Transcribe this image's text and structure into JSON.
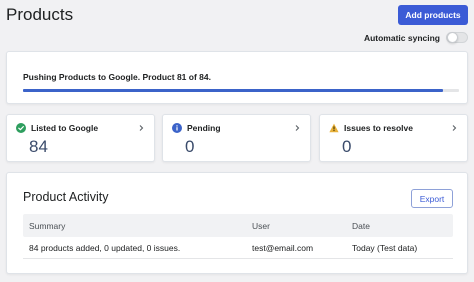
{
  "header": {
    "title": "Products",
    "add_button_label": "Add products",
    "sync_label": "Automatic syncing",
    "sync_enabled": false
  },
  "progress": {
    "message": "Pushing Products to Google. Product 81 of 84.",
    "current": 81,
    "total": 84,
    "fraction": 0.964
  },
  "stats": [
    {
      "label": "Listed to Google",
      "value": "84",
      "icon": "check-circle-icon",
      "icon_color": "#2e9e5e"
    },
    {
      "label": "Pending",
      "value": "0",
      "icon": "info-circle-icon",
      "icon_color": "#3b63c9"
    },
    {
      "label": "Issues to resolve",
      "value": "0",
      "icon": "warning-triangle-icon",
      "icon_color": "#e8b13a"
    }
  ],
  "activity": {
    "title": "Product Activity",
    "export_label": "Export",
    "columns": [
      "Summary",
      "User",
      "Date"
    ],
    "rows": [
      [
        "84 products added, 0 updated, 0 issues.",
        "test@email.com",
        "Today (Test data)"
      ]
    ]
  },
  "colors": {
    "primary": "#3b5bd6",
    "progress": "#3b63c9",
    "background": "#f1f1f3"
  }
}
